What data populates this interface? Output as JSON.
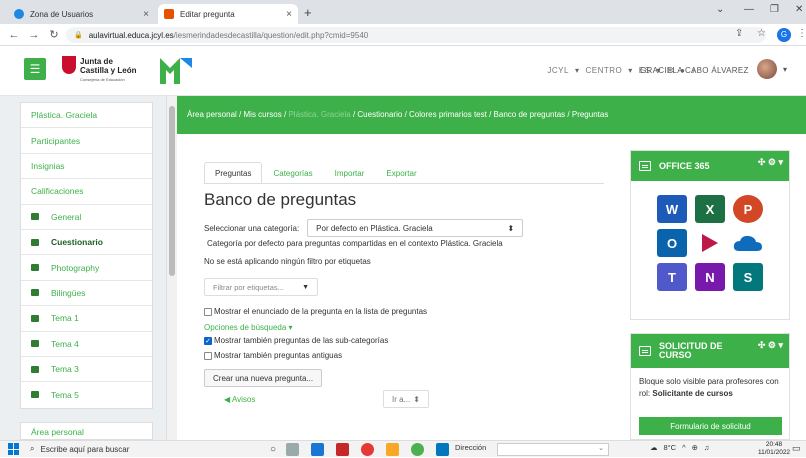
{
  "browser": {
    "tabs": [
      {
        "title": "Zona de Usuarios",
        "close": "×"
      },
      {
        "title": "Editar pregunta",
        "close": "×"
      }
    ],
    "new_tab": "+",
    "url_domain": "aulavirtual.educa.jcyl.es",
    "url_path": "/iesmerindadesdecastilla/question/edit.php?cmid=9540",
    "profile_letter": "G"
  },
  "header": {
    "logo_line1": "Junta de",
    "logo_line2": "Castilla y León",
    "logo_sub": "Consejería de Educación",
    "menu": [
      "JCYL",
      "CENTRO",
      "ES"
    ],
    "username": "GRACIELA CABO ÁLVAREZ"
  },
  "sidebar": {
    "items": [
      {
        "label": "Plástica. Graciela"
      },
      {
        "label": "Participantes"
      },
      {
        "label": "Insignias"
      },
      {
        "label": "Calificaciones"
      },
      {
        "label": "General"
      },
      {
        "label": "Cuestionario"
      },
      {
        "label": "Photography"
      },
      {
        "label": "Bilingües"
      },
      {
        "label": "Tema 1"
      },
      {
        "label": "Tema 4"
      },
      {
        "label": "Tema 3"
      },
      {
        "label": "Tema 5"
      }
    ],
    "bottom": "Área personal"
  },
  "breadcrumb": {
    "b1": "Área personal",
    "b2": "Mis cursos",
    "b3": "Plástica. Graciela",
    "b4": "Cuestionario",
    "b5": "Colores primarios test",
    "b6": "Banco de preguntas",
    "b7": "Preguntas",
    "sep": "/"
  },
  "main": {
    "tabs": [
      "Preguntas",
      "Categorías",
      "Importar",
      "Exportar"
    ],
    "title": "Banco de preguntas",
    "category_label": "Seleccionar una categoría:",
    "category_value": "Por defecto en Plástica. Graciela",
    "category_desc": "Categoría por defecto para preguntas compartidas en el contexto Plástica. Graciela",
    "no_filter": "No se está aplicando ningún filtro por etiquetas",
    "tag_placeholder": "Filtrar por etiquetas...",
    "chk_show_text": "Mostrar el enunciado de la pregunta en la lista de preguntas",
    "search_options": "Opciones de búsqueda",
    "chk_subcats": "Mostrar también preguntas de las sub-categorías",
    "chk_old": "Mostrar también preguntas antiguas",
    "create_button": "Crear una nueva pregunta...",
    "avisos": "Avisos",
    "goto": "Ir a..."
  },
  "right": {
    "office_title": "OFFICE 365",
    "solicitud_title_1": "SOLICITUD DE",
    "solicitud_title_2": "CURSO",
    "solicitud_text": "Bloque solo visible para profesores con rol:",
    "solicitud_role": "Solicitante de cursos",
    "form_button": "Formulario de solicitud",
    "block_controls": "✣ ⚙ ▾"
  },
  "taskbar": {
    "search": "Escribe aquí para buscar",
    "address_label": "Dirección",
    "temp": "8°C",
    "time": "20:48",
    "date": "11/01/2022"
  }
}
